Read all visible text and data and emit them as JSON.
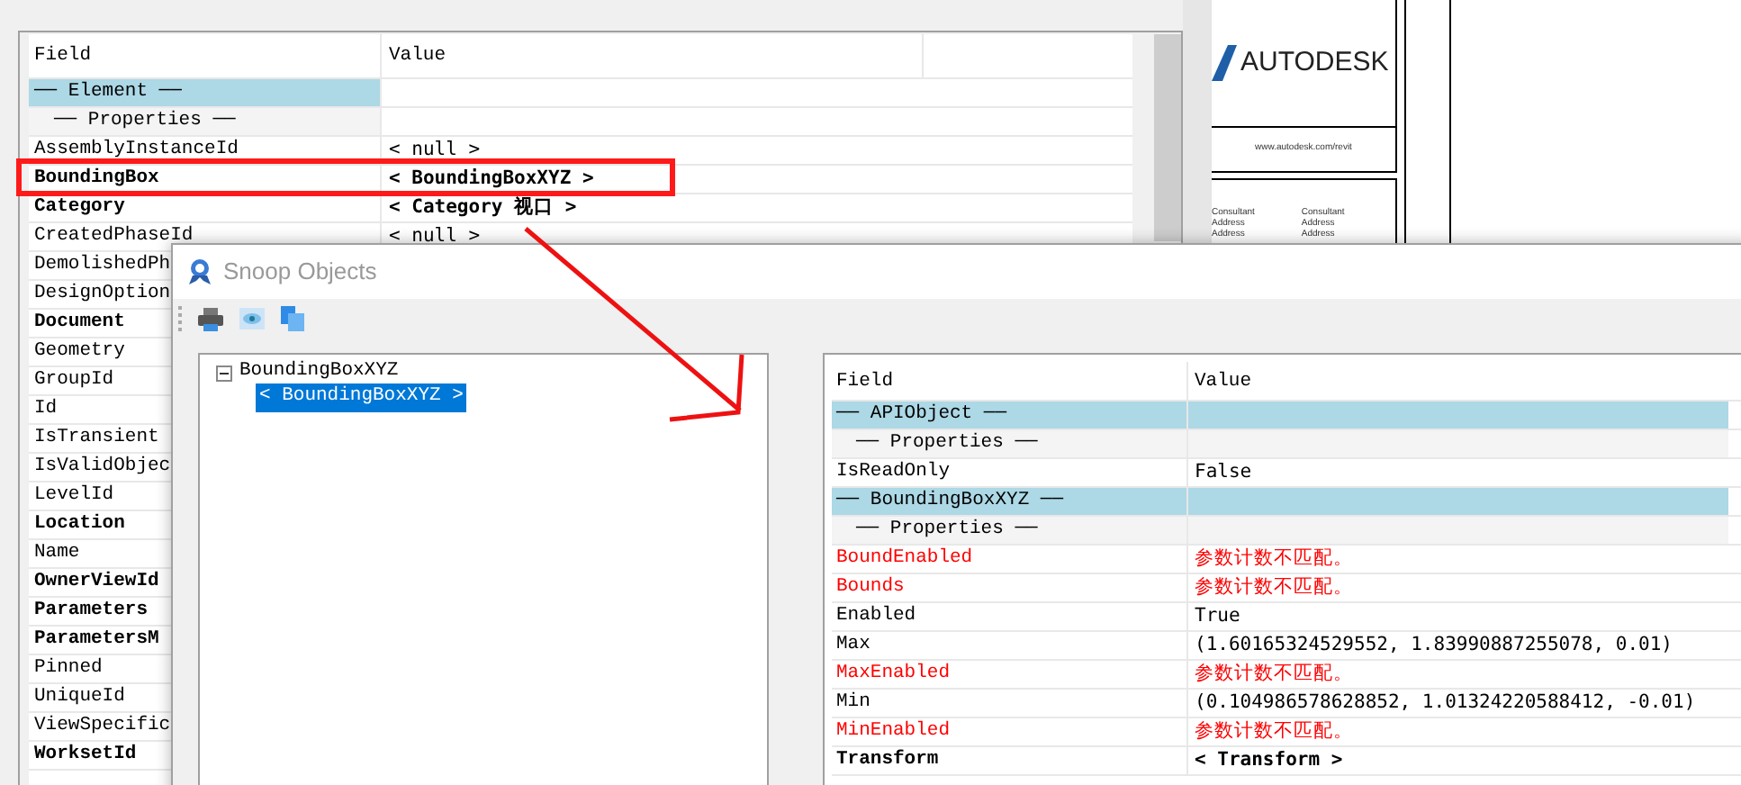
{
  "background_window": {
    "columns": [
      "Field",
      "Value"
    ],
    "rows": [
      {
        "kind": "section",
        "field": "── Element ──"
      },
      {
        "kind": "subsection",
        "field": "── Properties ──"
      },
      {
        "kind": "value",
        "field": "AssemblyInstanceId",
        "value": "< null >"
      },
      {
        "kind": "object",
        "field": "BoundingBox",
        "value": "< BoundingBoxXYZ >",
        "highlighted": true
      },
      {
        "kind": "object",
        "field": "Category",
        "value": "< Category  视口 >"
      },
      {
        "kind": "value",
        "field": "CreatedPhaseId",
        "value": "< null >"
      },
      {
        "kind": "value",
        "field": "DemolishedPh"
      },
      {
        "kind": "value",
        "field": "DesignOption"
      },
      {
        "kind": "object",
        "field": "Document"
      },
      {
        "kind": "value",
        "field": "Geometry"
      },
      {
        "kind": "value",
        "field": "GroupId"
      },
      {
        "kind": "value",
        "field": "Id"
      },
      {
        "kind": "value",
        "field": "IsTransient"
      },
      {
        "kind": "value",
        "field": "IsValidObjec"
      },
      {
        "kind": "value",
        "field": "LevelId"
      },
      {
        "kind": "object",
        "field": "Location"
      },
      {
        "kind": "value",
        "field": "Name"
      },
      {
        "kind": "object",
        "field": "OwnerViewId"
      },
      {
        "kind": "object",
        "field": "Parameters"
      },
      {
        "kind": "object",
        "field": "ParametersM"
      },
      {
        "kind": "value",
        "field": "Pinned"
      },
      {
        "kind": "value",
        "field": "UniqueId"
      },
      {
        "kind": "value",
        "field": "ViewSpecific"
      },
      {
        "kind": "object",
        "field": "WorksetId"
      }
    ]
  },
  "sheet": {
    "logo": "AUTODESK",
    "url": "www.autodesk.com/revit",
    "consultants": [
      [
        "Consultant",
        "Address",
        "Address"
      ],
      [
        "Consultant",
        "Address",
        "Address"
      ]
    ]
  },
  "snoop_window": {
    "title": "Snoop Objects",
    "tree": [
      {
        "label": "BoundingBoxXYZ",
        "expanded": true,
        "selected": false,
        "children": [
          {
            "label": "< BoundingBoxXYZ >",
            "selected": true
          }
        ]
      }
    ],
    "columns": [
      "Field",
      "Value"
    ],
    "rows": [
      {
        "kind": "section",
        "field": "── APIObject ──"
      },
      {
        "kind": "subsection",
        "field": "── Properties ──"
      },
      {
        "kind": "value",
        "field": "IsReadOnly",
        "value": "False"
      },
      {
        "kind": "section",
        "field": "── BoundingBoxXYZ ──"
      },
      {
        "kind": "subsection",
        "field": "── Properties ──"
      },
      {
        "kind": "error",
        "field": "BoundEnabled",
        "value": "参数计数不匹配。"
      },
      {
        "kind": "error",
        "field": "Bounds",
        "value": "参数计数不匹配。"
      },
      {
        "kind": "value",
        "field": "Enabled",
        "value": "True"
      },
      {
        "kind": "value",
        "field": "Max",
        "value": "(1.60165324529552, 1.83990887255078, 0.01)"
      },
      {
        "kind": "error",
        "field": "MaxEnabled",
        "value": "参数计数不匹配。"
      },
      {
        "kind": "value",
        "field": "Min",
        "value": "(0.104986578628852, 1.01324220588412, -0.01)"
      },
      {
        "kind": "error",
        "field": "MinEnabled",
        "value": "参数计数不匹配。"
      },
      {
        "kind": "object",
        "field": "Transform",
        "value": "< Transform >"
      }
    ]
  }
}
